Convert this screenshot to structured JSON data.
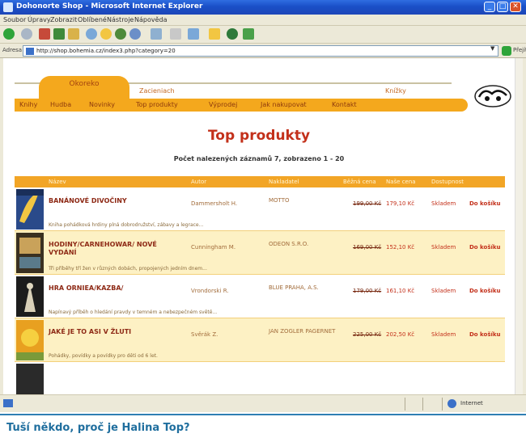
{
  "window": {
    "title": "Dohonorte Shop - Microsoft Internet Explorer",
    "min": "_",
    "max": "□",
    "close": "✕"
  },
  "menu": [
    "Soubor",
    "Úpravy",
    "Zobrazit",
    "Oblíbené",
    "Nástroje",
    "Nápověda"
  ],
  "address": {
    "label": "Adresa",
    "url": "http://shop.bohemia.cz/index3.php?category=20",
    "go": "Přejít"
  },
  "site": {
    "tab_active": "Okoreko",
    "tab_2": "Zacieniach",
    "tab_3": "Knížky",
    "nav": [
      "Knihy",
      "Hudba",
      "Novinky",
      "Top produkty",
      "Výprodej",
      "Jak nakupovat",
      "Kontakt"
    ]
  },
  "page": {
    "title": "Top produkty",
    "subtitle": "Počet nalezených záznamů 7, zobrazeno 1 - 20"
  },
  "table": {
    "headers": [
      "Název",
      "Autor",
      "Nakladatel",
      "Běžná cena",
      "Naše cena",
      "Dostupnost",
      ""
    ],
    "rows": [
      {
        "name": "BANÁNOVÉ DIVOČINY",
        "author": "Dammersholt H.",
        "publisher": "MOTTO",
        "old_price": "199,00 Kč",
        "new_price": "179,10 Kč",
        "stock": "Skladem",
        "cart": "Do košíku",
        "desc": "Kniha pohádková hrdiny plná dobrodružství, zábavy a legrace..."
      },
      {
        "name": "HODINY/CARNEHOWAR/ NOVÉ VYDÁNÍ",
        "author": "Cunningham M.",
        "publisher": "ODEON S.R.O.",
        "old_price": "169,00 Kč",
        "new_price": "152,10 Kč",
        "stock": "Skladem",
        "cart": "Do košíku",
        "desc": "Tři příběhy tří žen v různých dobách, propojených jedním dnem..."
      },
      {
        "name": "HRA ORNIEA/KAZBA/",
        "author": "Vrondorski R.",
        "publisher": "BLUE PRAHA, A.S.",
        "old_price": "179,00 Kč",
        "new_price": "161,10 Kč",
        "stock": "Skladem",
        "cart": "Do košíku",
        "desc": "Napínavý příběh o hledání pravdy v temném a nebezpečném světě..."
      },
      {
        "name": "JAKÉ JE TO ASI V ŽLUTI",
        "author": "Svěrák Z.",
        "publisher": "JAN ZOGLER PAGERNET",
        "old_price": "225,00 Kč",
        "new_price": "202,50 Kč",
        "stock": "Skladem",
        "cart": "Do košíku",
        "desc": "Pohádky, povídky a povídky pro děti od 6 let."
      }
    ]
  },
  "status": {
    "zone": "Internet"
  },
  "caption": "Tuší někdo, proč je Halina Top?",
  "colors": {
    "accent": "#f4a81d",
    "title": "#c3301a",
    "caption": "#1f6e9e"
  }
}
